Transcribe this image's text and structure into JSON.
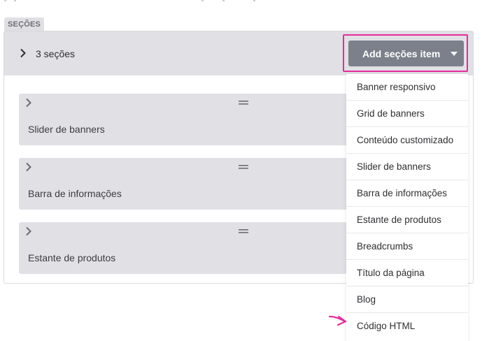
{
  "sections_tab": {
    "label": "SEÇÕES"
  },
  "header": {
    "title": "3 seções",
    "add_button_label": "Add seções item"
  },
  "items": [
    {
      "label": "Slider de banners"
    },
    {
      "label": "Barra de informações"
    },
    {
      "label": "Estante de produtos"
    }
  ],
  "dropdown": {
    "options": [
      "Banner responsivo",
      "Grid de banners",
      "Conteúdo customizado",
      "Slider de banners",
      "Barra de informações",
      "Estante de produtos",
      "Breadcrumbs",
      "Título da página",
      "Blog",
      "Código HTML"
    ]
  },
  "colors": {
    "highlight": "#e62c9c",
    "button": "#7b808a",
    "panel": "#e1e0e5"
  },
  "icons": [
    "chevron-right-icon",
    "caret-down-icon",
    "drag-handle-icon",
    "arrow-annotation-icon"
  ]
}
